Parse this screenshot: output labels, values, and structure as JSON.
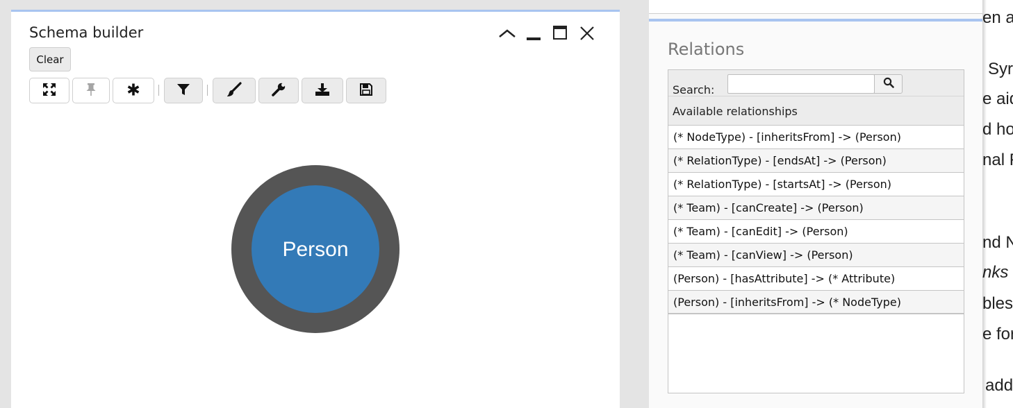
{
  "schema_builder": {
    "title": "Schema builder",
    "clear_label": "Clear",
    "toolbar_icons": [
      "expand-arrows-icon",
      "pin-icon",
      "asterisk-icon",
      "filter-icon",
      "paintbrush-icon",
      "wrench-icon",
      "download-icon",
      "save-icon"
    ],
    "node": {
      "label": "Person",
      "fill": "#337ab7",
      "ring": "#555555"
    }
  },
  "relations": {
    "title": "Relations",
    "search_label": "Search:",
    "search_value": "",
    "list_header": "Available relationships",
    "items": [
      "(* NodeType) - [inheritsFrom] -> (Person)",
      "(* RelationType) - [endsAt] -> (Person)",
      "(* RelationType) - [startsAt] -> (Person)",
      "(* Team) - [canCreate] -> (Person)",
      "(* Team) - [canEdit] -> (Person)",
      "(* Team) - [canView] -> (Person)",
      "(Person) - [hasAttribute] -> (* Attribute)",
      "(Person) - [inheritsFrom] -> (* NodeType)"
    ]
  },
  "background_text": {
    "fragments": [
      "en a",
      "Syr",
      "e aid",
      "d ho",
      "nal F",
      "nd N",
      "nks",
      "bles",
      "e for",
      "add"
    ]
  },
  "colors": {
    "accent": "#a8c4f0",
    "node_fill": "#337ab7"
  }
}
